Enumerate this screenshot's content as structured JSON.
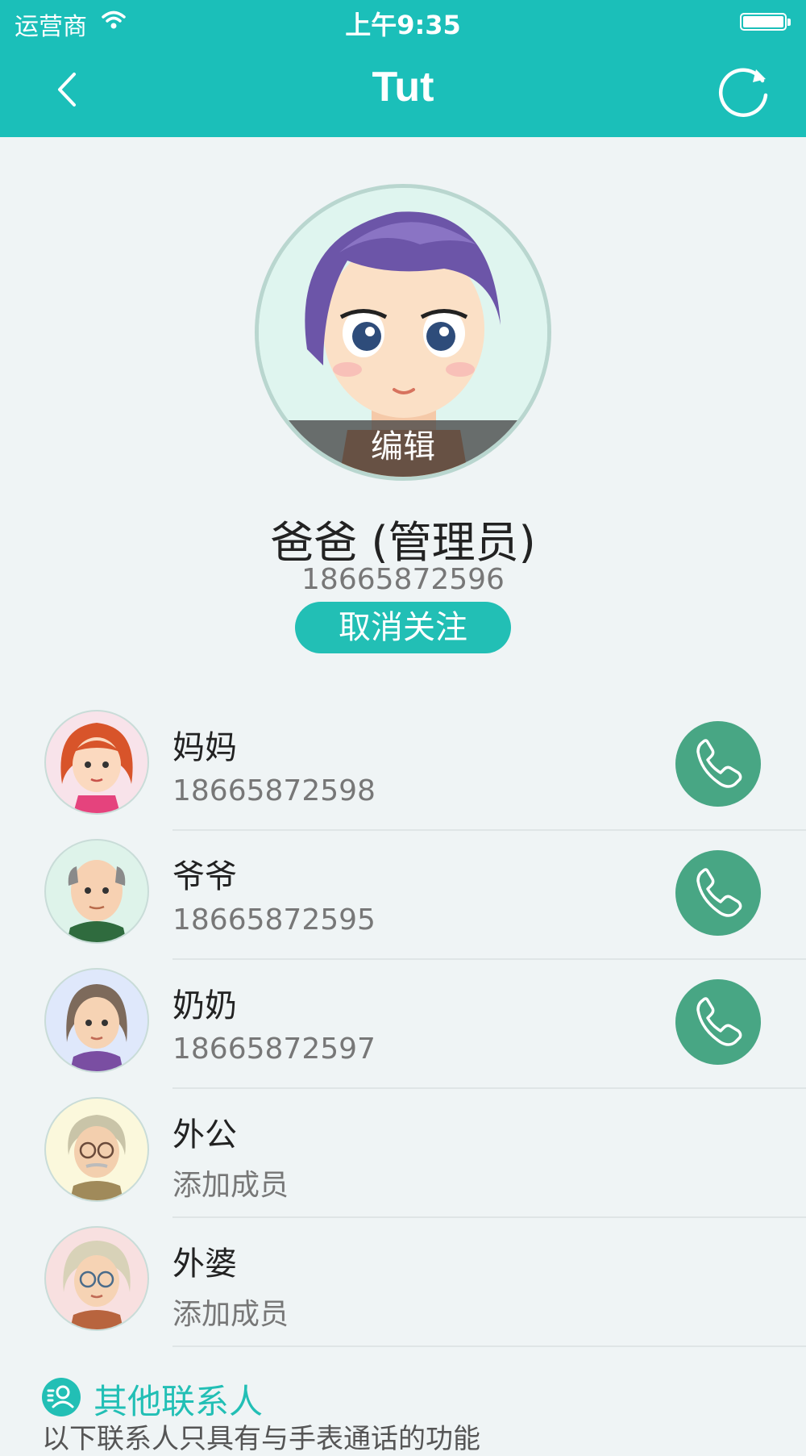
{
  "status_bar": {
    "carrier": "运营商",
    "time": "上午9:35"
  },
  "nav": {
    "title": "Tut"
  },
  "profile": {
    "edit_label": "编辑",
    "name": "爸爸 (管理员)",
    "phone": "18665872596",
    "unfollow_label": "取消关注"
  },
  "members": [
    {
      "name": "妈妈",
      "sub": "18665872598",
      "callable": true
    },
    {
      "name": "爷爷",
      "sub": "18665872595",
      "callable": true
    },
    {
      "name": "奶奶",
      "sub": "18665872597",
      "callable": true
    },
    {
      "name": "外公",
      "sub": "添加成员",
      "callable": false
    },
    {
      "name": "外婆",
      "sub": "添加成员",
      "callable": false
    }
  ],
  "other_contacts": {
    "title": "其他联系人",
    "note": "以下联系人只具有与手表通话的功能"
  },
  "colors": {
    "accent": "#1bbfb9",
    "call": "#48a684"
  }
}
